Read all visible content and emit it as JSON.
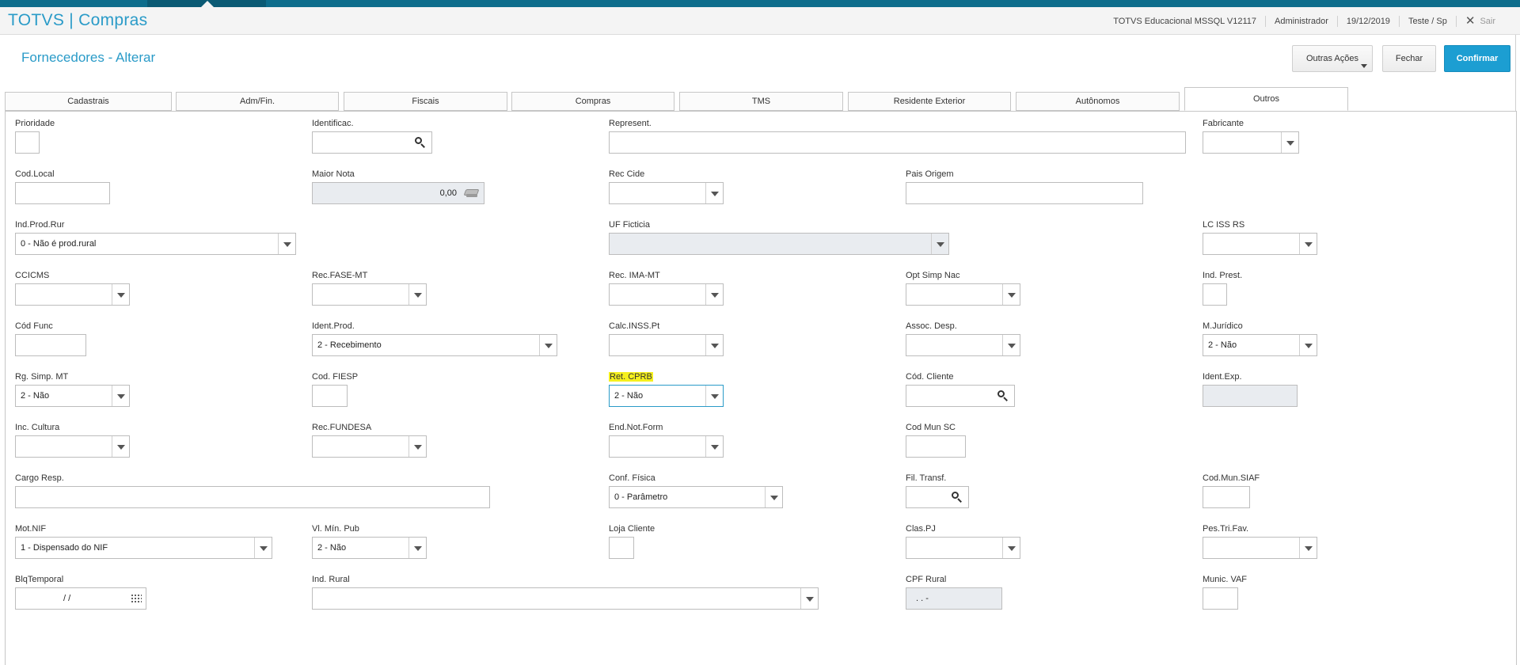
{
  "app": {
    "title": "TOTVS | Compras",
    "environment": "TOTVS Educacional MSSQL V12117",
    "user": "Administrador",
    "date": "19/12/2019",
    "branch": "Teste / Sp",
    "exit_label": "Sair"
  },
  "page": {
    "title": "Fornecedores - Alterar",
    "buttons": {
      "more": "Outras Ações",
      "close": "Fechar",
      "confirm": "Confirmar"
    }
  },
  "tabs": [
    {
      "label": "Cadastrais"
    },
    {
      "label": "Adm/Fin."
    },
    {
      "label": "Fiscais"
    },
    {
      "label": "Compras"
    },
    {
      "label": "TMS"
    },
    {
      "label": "Residente Exterior"
    },
    {
      "label": "Autônomos"
    },
    {
      "label": "Outros"
    }
  ],
  "active_tab": "Outros",
  "fields": {
    "prioridade": {
      "label": "Prioridade",
      "value": ""
    },
    "identificac": {
      "label": "Identificac.",
      "value": ""
    },
    "represent": {
      "label": "Represent.",
      "value": ""
    },
    "fabricante": {
      "label": "Fabricante",
      "value": ""
    },
    "cod_local": {
      "label": "Cod.Local",
      "value": ""
    },
    "maior_nota": {
      "label": "Maior Nota",
      "value": "0,00"
    },
    "rec_cide": {
      "label": "Rec Cide",
      "value": ""
    },
    "pais_origem": {
      "label": "Pais Origem",
      "value": ""
    },
    "ind_prod_rur": {
      "label": "Ind.Prod.Rur",
      "value": "0 - Não é prod.rural"
    },
    "uf_ficticia": {
      "label": "UF Ficticia",
      "value": ""
    },
    "lc_iss_rs": {
      "label": "LC ISS RS",
      "value": ""
    },
    "ccicms": {
      "label": "CCICMS",
      "value": ""
    },
    "rec_fase_mt": {
      "label": "Rec.FASE-MT",
      "value": ""
    },
    "rec_ima_mt": {
      "label": "Rec. IMA-MT",
      "value": ""
    },
    "opt_simp_nac": {
      "label": "Opt Simp Nac",
      "value": ""
    },
    "ind_prest": {
      "label": "Ind. Prest.",
      "value": ""
    },
    "cod_func": {
      "label": "Cód Func",
      "value": ""
    },
    "ident_prod": {
      "label": "Ident.Prod.",
      "value": "2 - Recebimento"
    },
    "calc_inss_pt": {
      "label": "Calc.INSS.Pt",
      "value": ""
    },
    "assoc_desp": {
      "label": "Assoc. Desp.",
      "value": ""
    },
    "m_juridico": {
      "label": "M.Jurídico",
      "value": "2 - Não"
    },
    "rg_simp_mt": {
      "label": "Rg. Simp. MT",
      "value": "2 - Não"
    },
    "cod_fiesp": {
      "label": "Cod. FIESP",
      "value": ""
    },
    "ret_cprb": {
      "label": "Ret. CPRB",
      "value": "2 - Não"
    },
    "cod_cliente": {
      "label": "Cód. Cliente",
      "value": ""
    },
    "ident_exp": {
      "label": "Ident.Exp.",
      "value": ""
    },
    "inc_cultura": {
      "label": "Inc. Cultura",
      "value": ""
    },
    "rec_fundesa": {
      "label": "Rec.FUNDESA",
      "value": ""
    },
    "end_not_form": {
      "label": "End.Not.Form",
      "value": ""
    },
    "cod_mun_sc": {
      "label": "Cod Mun SC",
      "value": ""
    },
    "cargo_resp": {
      "label": "Cargo Resp.",
      "value": ""
    },
    "conf_fisica": {
      "label": "Conf. Física",
      "value": "0 - Parâmetro"
    },
    "fil_transf": {
      "label": "Fil. Transf.",
      "value": ""
    },
    "cod_mun_siaf": {
      "label": "Cod.Mun.SIAF",
      "value": ""
    },
    "mot_nif": {
      "label": "Mot.NIF",
      "value": "1 - Dispensado do NIF"
    },
    "vl_min_pub": {
      "label": "Vl. Mín. Pub",
      "value": "2 - Não"
    },
    "loja_cliente": {
      "label": "Loja Cliente",
      "value": ""
    },
    "clas_pj": {
      "label": "Clas.PJ",
      "value": ""
    },
    "pes_tri_fav": {
      "label": "Pes.Tri.Fav.",
      "value": ""
    },
    "blq_temporal": {
      "label": "BlqTemporal",
      "value": "/ /"
    },
    "ind_rural": {
      "label": "Ind. Rural",
      "value": ""
    },
    "cpf_rural": {
      "label": "CPF Rural",
      "value": ". . -"
    },
    "munic_vaf": {
      "label": "Munic. VAF",
      "value": ""
    }
  }
}
